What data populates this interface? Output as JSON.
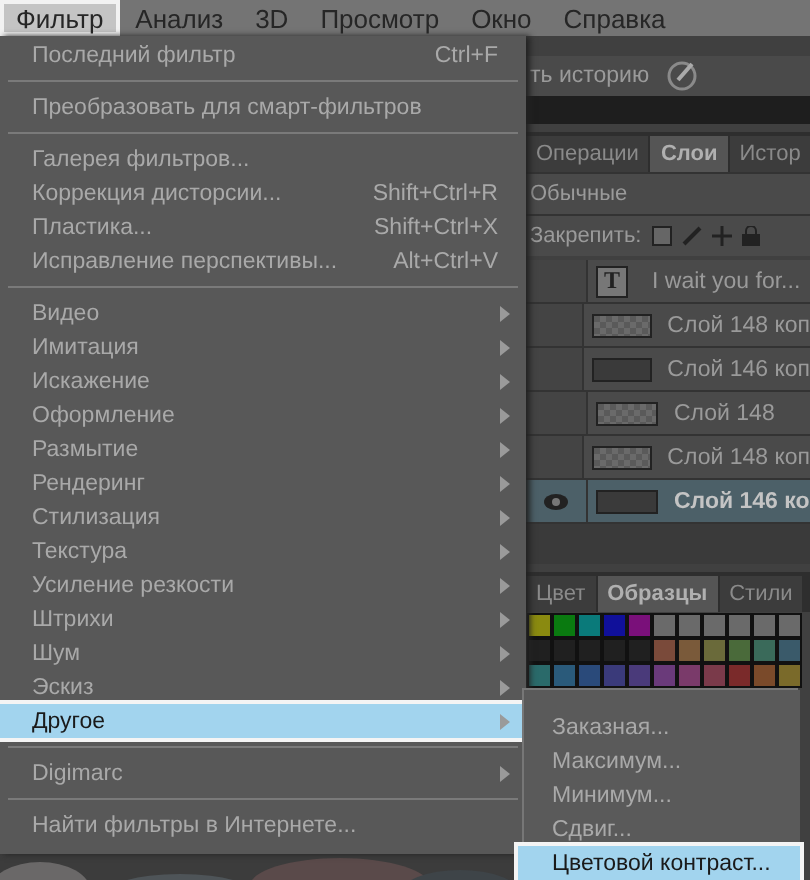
{
  "menubar": [
    {
      "label": "Фильтр",
      "selected": true
    },
    {
      "label": "Анализ",
      "selected": false
    },
    {
      "label": "3D",
      "selected": false
    },
    {
      "label": "Просмотр",
      "selected": false
    },
    {
      "label": "Окно",
      "selected": false
    },
    {
      "label": "Справка",
      "selected": false
    }
  ],
  "filter_menu": [
    {
      "kind": "command",
      "label": "Последний фильтр",
      "shortcut": "Ctrl+F",
      "selected": false
    },
    {
      "kind": "separator"
    },
    {
      "kind": "command",
      "label": "Преобразовать для смарт-фильтров",
      "selected": false
    },
    {
      "kind": "separator"
    },
    {
      "kind": "command",
      "label": "Галерея фильтров...",
      "selected": false
    },
    {
      "kind": "command",
      "label": "Коррекция дисторсии...",
      "shortcut": "Shift+Ctrl+R",
      "selected": false
    },
    {
      "kind": "command",
      "label": "Пластика...",
      "shortcut": "Shift+Ctrl+X",
      "selected": false
    },
    {
      "kind": "command",
      "label": "Исправление перспективы...",
      "shortcut": "Alt+Ctrl+V",
      "selected": false
    },
    {
      "kind": "separator"
    },
    {
      "kind": "submenu",
      "label": "Видео",
      "selected": false
    },
    {
      "kind": "submenu",
      "label": "Имитация",
      "selected": false
    },
    {
      "kind": "submenu",
      "label": "Искажение",
      "selected": false
    },
    {
      "kind": "submenu",
      "label": "Оформление",
      "selected": false
    },
    {
      "kind": "submenu",
      "label": "Размытие",
      "selected": false
    },
    {
      "kind": "submenu",
      "label": "Рендеринг",
      "selected": false
    },
    {
      "kind": "submenu",
      "label": "Стилизация",
      "selected": false
    },
    {
      "kind": "submenu",
      "label": "Текстура",
      "selected": false
    },
    {
      "kind": "submenu",
      "label": "Усиление резкости",
      "selected": false
    },
    {
      "kind": "submenu",
      "label": "Штрихи",
      "selected": false
    },
    {
      "kind": "submenu",
      "label": "Шум",
      "selected": false
    },
    {
      "kind": "submenu",
      "label": "Эскиз",
      "selected": false
    },
    {
      "kind": "submenu",
      "label": "Другое",
      "selected": true
    },
    {
      "kind": "separator"
    },
    {
      "kind": "submenu",
      "label": "Digimarc",
      "selected": false
    },
    {
      "kind": "separator"
    },
    {
      "kind": "command",
      "label": "Найти фильтры в Интернете...",
      "selected": false
    }
  ],
  "submenu": [
    {
      "label": "Заказная...",
      "selected": false
    },
    {
      "label": "Максимум...",
      "selected": false
    },
    {
      "label": "Минимум...",
      "selected": false
    },
    {
      "label": "Сдвиг...",
      "selected": false
    },
    {
      "label": "Цветовой контраст...",
      "selected": true
    }
  ],
  "history_hint": "ть историю",
  "layers_panel": {
    "tabs": [
      {
        "label": "Операции",
        "selected": false
      },
      {
        "label": "Слои",
        "selected": true
      },
      {
        "label": "Истор",
        "selected": false
      }
    ],
    "blend_mode": "Обычные",
    "lock_label": "Закрепить:",
    "layers": [
      {
        "name": "I wait you for...",
        "kind": "text",
        "thumb_label": "T",
        "visible": false,
        "selected": false
      },
      {
        "name": "Слой 148 коп",
        "kind": "transparent",
        "visible": false,
        "selected": false
      },
      {
        "name": "Слой 146 коп",
        "kind": "filled",
        "visible": false,
        "selected": false
      },
      {
        "name": "Слой 148",
        "kind": "transparent",
        "visible": false,
        "selected": false
      },
      {
        "name": "Слой 148 коп",
        "kind": "transparent",
        "visible": false,
        "selected": false
      },
      {
        "name": "Слой 146 ко",
        "kind": "filled",
        "visible": true,
        "selected": true
      }
    ]
  },
  "swatches_panel": {
    "tabs": [
      {
        "label": "Цвет",
        "selected": false
      },
      {
        "label": "Образцы",
        "selected": true
      },
      {
        "label": "Стили",
        "selected": false
      }
    ]
  }
}
